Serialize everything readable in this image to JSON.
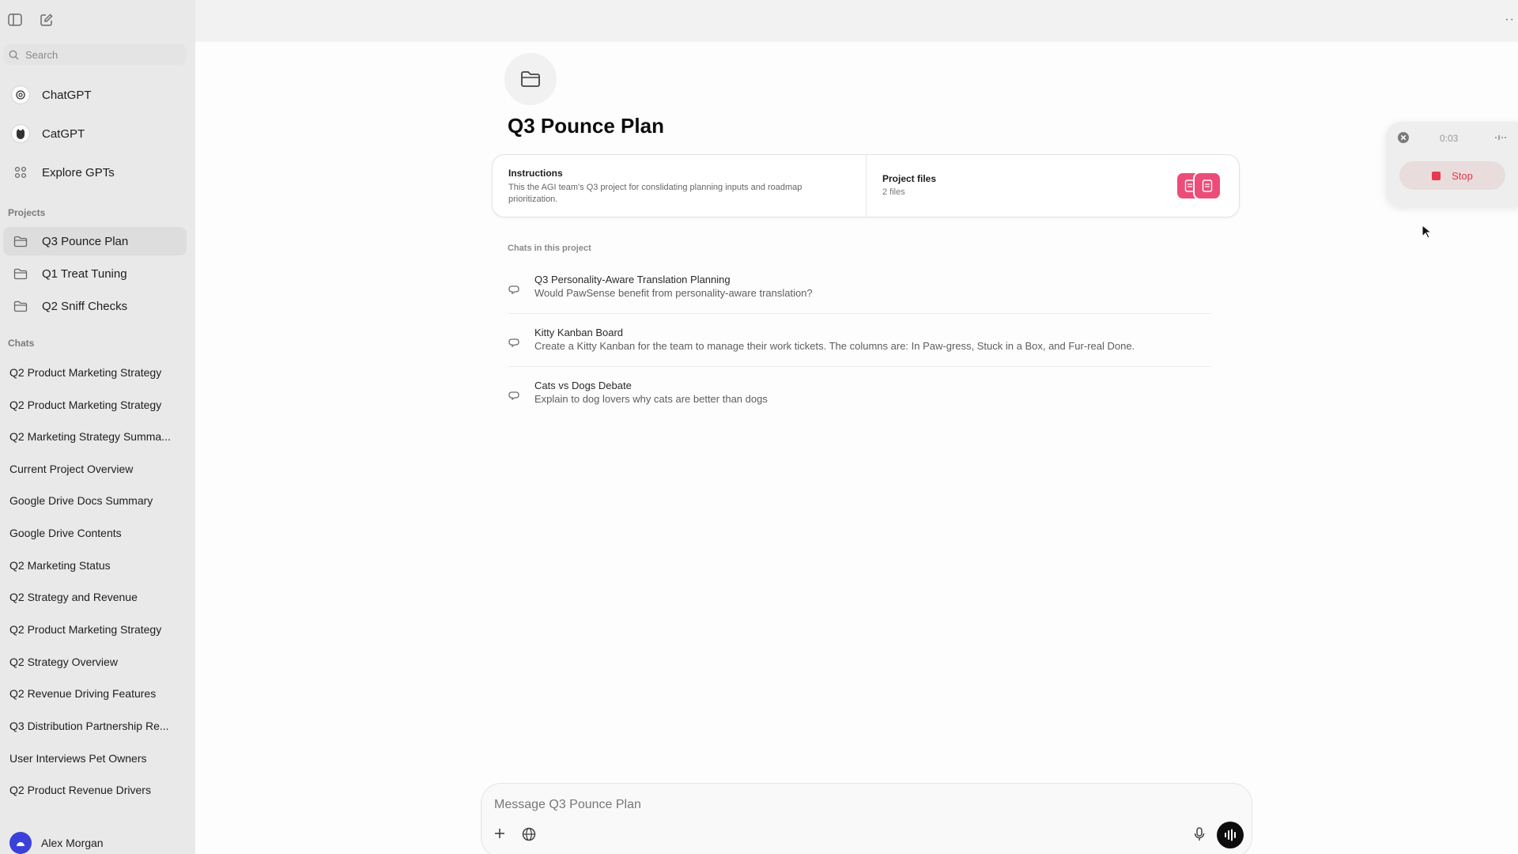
{
  "sidebar": {
    "search_placeholder": "Search",
    "gpts": [
      {
        "label": "ChatGPT",
        "icon": "openai-logo-icon"
      },
      {
        "label": "CatGPT",
        "icon": "cat-avatar-icon"
      },
      {
        "label": "Explore GPTs",
        "icon": "grid-icon"
      }
    ],
    "projects_heading": "Projects",
    "projects": [
      {
        "label": "Q3 Pounce Plan",
        "active": true
      },
      {
        "label": "Q1 Treat Tuning"
      },
      {
        "label": "Q2 Sniff Checks"
      }
    ],
    "chats_heading": "Chats",
    "chats": [
      "Q2 Product Marketing Strategy",
      "Q2 Product Marketing Strategy",
      "Q2 Marketing Strategy Summa...",
      "Current Project Overview",
      "Google Drive Docs Summary",
      "Google Drive Contents",
      "Q2 Marketing Status",
      "Q2 Strategy and Revenue",
      "Q2 Product Marketing Strategy",
      "Q2 Strategy Overview",
      "Q2 Revenue Driving Features",
      "Q3 Distribution Partnership Re...",
      "User Interviews Pet Owners",
      "Q2 Product Revenue Drivers"
    ],
    "user_name": "Alex Morgan"
  },
  "main": {
    "title": "Q3 Pounce Plan",
    "instructions_heading": "Instructions",
    "instructions_text": "This the AGI team's Q3 project for conslidating planning inputs and roadmap prioritization.",
    "files_heading": "Project files",
    "files_count": "2 files",
    "chats_label": "Chats in this project",
    "project_chats": [
      {
        "title": "Q3 Personality-Aware Translation Planning",
        "snippet": "Would PawSense benefit from personality-aware translation?"
      },
      {
        "title": "Kitty Kanban Board",
        "snippet": "Create a Kitty Kanban for the team to manage their work tickets. The columns are: In Paw-gress, Stuck in a Box, and Fur-real Done."
      },
      {
        "title": "Cats vs Dogs Debate",
        "snippet": "Explain to dog lovers why cats are better than dogs"
      }
    ],
    "composer_placeholder": "Message Q3 Pounce Plan"
  },
  "recorder": {
    "timer": "0:03",
    "stop_label": "Stop"
  },
  "colors": {
    "accent_pink": "#ec4d78",
    "stop_red": "#e8384f",
    "avatar_blue": "#3b41d8"
  }
}
